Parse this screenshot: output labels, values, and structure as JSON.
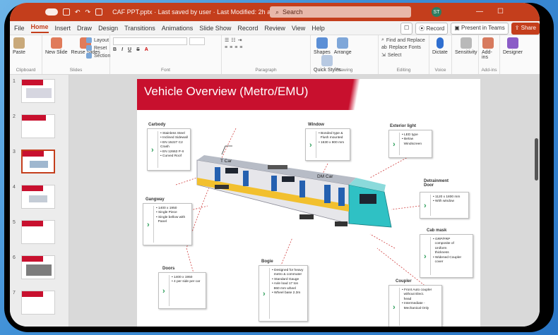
{
  "titlebar": {
    "filename": "CAF PPT.pptx · Last saved by user · Last Modified: 2h ago",
    "search_placeholder": "Search",
    "avatar_initials": "ST"
  },
  "menu": {
    "tabs": [
      "File",
      "Home",
      "Insert",
      "Draw",
      "Design",
      "Transitions",
      "Animations",
      "Slide Show",
      "Record",
      "Review",
      "View",
      "Help"
    ],
    "record": "Record",
    "present": "Present in Teams",
    "share": "Share"
  },
  "ribbon": {
    "paste": "Paste",
    "clipboard": "Clipboard",
    "new_slide": "New Slide",
    "reuse_slides": "Reuse Slides",
    "layout": "Layout",
    "reset": "Reset",
    "section": "Section",
    "slides": "Slides",
    "font": "Font",
    "paragraph": "Paragraph",
    "shapes": "Shapes",
    "arrange": "Arrange",
    "quick_styles": "Quick Styles",
    "drawing": "Drawing",
    "find_replace": "Find and Replace",
    "replace_fonts": "Replace Fonts",
    "select": "Select",
    "editing": "Editing",
    "dictate": "Dictate",
    "voice": "Voice",
    "sensitivity": "Sensitivity",
    "addins": "Add-ins",
    "addins_group": "Add-ins",
    "designer": "Designer"
  },
  "thumbnails": [
    "1",
    "2",
    "3",
    "4",
    "5",
    "6",
    "7"
  ],
  "slide": {
    "title": "Vehicle Overview (Metro/EMU)",
    "tcar": "T Car",
    "dmcar": "DM Car",
    "sections": {
      "carbody": {
        "label": "Carbody",
        "items": [
          "Stainless Steel",
          "Inclined Sidewall",
          "EN 15227 C2 Crash",
          "EN 12663 P-II",
          "Curved Roof"
        ]
      },
      "window": {
        "label": "Window",
        "items": [
          "Bonded type &",
          "Flush mounted",
          "1630 x 800 mm"
        ]
      },
      "exterior_light": {
        "label": "Exterior light",
        "items": [
          "LED type",
          "Below",
          "Windscreen"
        ]
      },
      "detrainment": {
        "label": "Detrainment Door",
        "items": [
          "1120 x 1800 mm",
          "With window"
        ]
      },
      "gangway": {
        "label": "Gangway",
        "items": [
          "1400 x 1950",
          "Single Piece",
          "Single bellow with",
          "Panel"
        ]
      },
      "cab_mask": {
        "label": "Cab mask",
        "items": [
          "GRP/FRP",
          "composite of",
          "Uniform",
          "thickness",
          "Widened Coupler",
          "cover"
        ]
      },
      "doors": {
        "label": "Doors",
        "items": [
          "1400 x 1950",
          "4 per side per car"
        ]
      },
      "bogie": {
        "label": "Bogie",
        "items": [
          "Designed for heavy",
          "metro & commuter",
          "Standard Gauge",
          "Axle load 17 ton",
          "860 mm wheel",
          "Wheel base 2.3m"
        ]
      },
      "coupler": {
        "label": "Coupler",
        "items": [
          "Front Auto coupler",
          "without Elect.",
          "head",
          "Intermediate -",
          "Mechanical Only"
        ]
      }
    }
  }
}
